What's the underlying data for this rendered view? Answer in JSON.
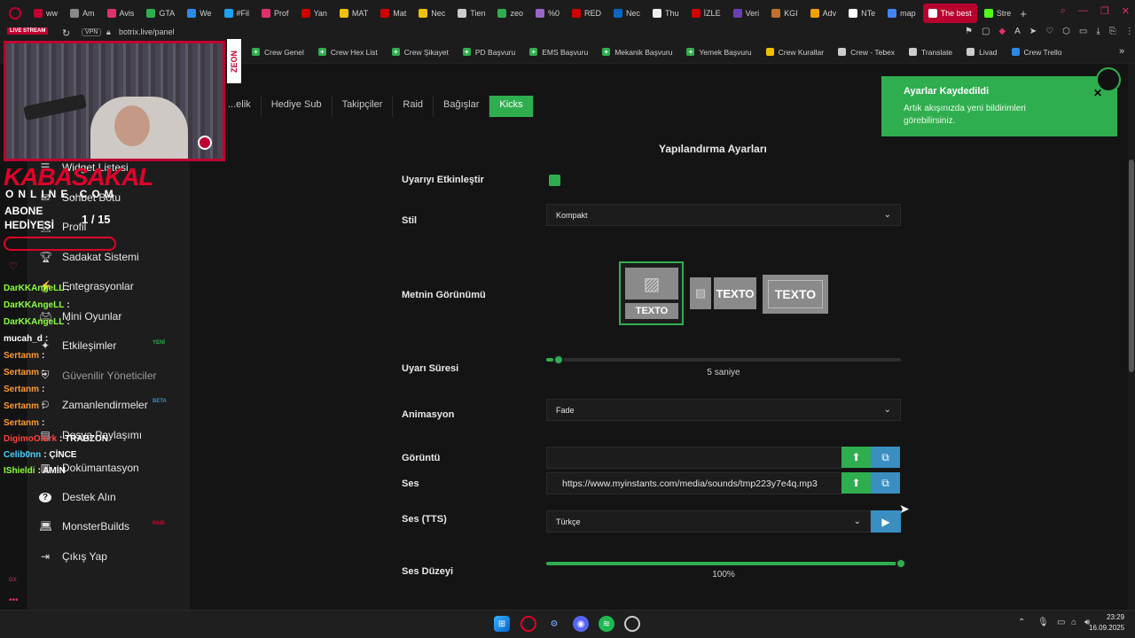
{
  "browser": {
    "tabs": [
      {
        "label": "ww",
        "color": "#c00030"
      },
      {
        "label": "Am",
        "color": "#888888"
      },
      {
        "label": "Avis",
        "color": "#e0306a"
      },
      {
        "label": "GTA",
        "color": "#2fae4f"
      },
      {
        "label": "We",
        "color": "#2b8ae6"
      },
      {
        "label": "#Fil",
        "color": "#1da1f2"
      },
      {
        "label": "Prof",
        "color": "#e0306a"
      },
      {
        "label": "Yan",
        "color": "#d10000"
      },
      {
        "label": "MAT",
        "color": "#f0c000"
      },
      {
        "label": "Mat",
        "color": "#d10000"
      },
      {
        "label": "Nec",
        "color": "#f0c000"
      },
      {
        "label": "Tien",
        "color": "#cccccc"
      },
      {
        "label": "zeo",
        "color": "#2fae4f"
      },
      {
        "label": "%0",
        "color": "#9966cc"
      },
      {
        "label": "RED",
        "color": "#d10000"
      },
      {
        "label": "Nec",
        "color": "#0a66c2"
      },
      {
        "label": "Thu",
        "color": "#eeeeee"
      },
      {
        "label": "İZLE",
        "color": "#d10000"
      },
      {
        "label": "Veri",
        "color": "#6a3fb5"
      },
      {
        "label": "KGI",
        "color": "#c07030"
      },
      {
        "label": "Adv",
        "color": "#f0a000"
      },
      {
        "label": "NTe",
        "color": "#ffffff"
      },
      {
        "label": "map",
        "color": "#4285f4"
      },
      {
        "label": "The best",
        "color": "#ffffff"
      },
      {
        "label": "Stre",
        "color": "#53fc18"
      }
    ],
    "url": "botrix.live/panel",
    "vpn_label": "VPN",
    "bookmarks": [
      {
        "label": "Crew Genel",
        "kind": "plus"
      },
      {
        "label": "Crew Hex List",
        "kind": "plus"
      },
      {
        "label": "Crew Şikayet",
        "kind": "plus"
      },
      {
        "label": "PD Başvuru",
        "kind": "plus"
      },
      {
        "label": "EMS Başvuru",
        "kind": "plus"
      },
      {
        "label": "Mekanik Başvuru",
        "kind": "plus"
      },
      {
        "label": "Yemek Başvuru",
        "kind": "plus"
      },
      {
        "label": "Crew Kurallar",
        "kind": "yellow"
      },
      {
        "label": "Crew - Tebex",
        "kind": "pin"
      },
      {
        "label": "Translate",
        "kind": "arrow"
      },
      {
        "label": "Livad",
        "kind": "circle"
      },
      {
        "label": "Crew Trello",
        "kind": "blue"
      }
    ]
  },
  "sidebar": {
    "items": [
      {
        "label": "Widget Listesi",
        "icon": "list-icon"
      },
      {
        "label": "Sohbet Botu",
        "icon": "chat-icon"
      },
      {
        "label": "Profil",
        "icon": "user-icon"
      },
      {
        "label": "Sadakat Sistemi",
        "icon": "trophy-icon"
      },
      {
        "label": "Entegrasyonlar",
        "icon": "plug-icon"
      },
      {
        "label": "Mini Oyunlar",
        "icon": "gamepad-icon"
      },
      {
        "label": "Etkileşimler",
        "icon": "interaction-icon",
        "badge": "YENİ"
      },
      {
        "label": "Güvenilir Yöneticiler",
        "icon": "shield-icon"
      },
      {
        "label": "Zamanlendirmeler",
        "icon": "clock-icon",
        "badge": "BETA"
      },
      {
        "label": "Dosya Paylaşımı",
        "icon": "file-icon"
      },
      {
        "label": "Dokümantasyon",
        "icon": "book-icon"
      },
      {
        "label": "Destek Alın",
        "icon": "help-icon"
      },
      {
        "label": "MonsterBuilds",
        "icon": "laptop-icon",
        "badge": "PAID"
      },
      {
        "label": "Çıkış Yap",
        "icon": "logout-icon"
      }
    ]
  },
  "content_tabs": [
    {
      "label": "...elik",
      "active": false
    },
    {
      "label": "Hediye Sub",
      "active": false
    },
    {
      "label": "Takipçiler",
      "active": false
    },
    {
      "label": "Raid",
      "active": false
    },
    {
      "label": "Bağışlar",
      "active": false
    },
    {
      "label": "Kicks",
      "active": true
    }
  ],
  "config": {
    "title": "Yapılandırma Ayarları",
    "enable_label": "Uyarıyı Etkinleştir",
    "enable_checked": true,
    "style_label": "Stil",
    "style_value": "Kompakt",
    "text_view_label": "Metnin Görünümü",
    "text_view_options": [
      "TEXTO",
      "TEXTO",
      "TEXTO"
    ],
    "duration_label": "Uyarı Süresi",
    "duration_value": "5 saniye",
    "duration_fraction": 0.02,
    "animation_label": "Animasyon",
    "animation_value": "Fade",
    "image_label": "Görüntü",
    "image_value": "",
    "sound_label": "Ses",
    "sound_value": "https://www.myinstants.com/media/sounds/tmp223y7e4q.mp3",
    "tts_label": "Ses (TTS)",
    "tts_value": "Türkçe",
    "volume_label": "Ses Düzeyi",
    "volume_value": "100%",
    "volume_fraction": 1.0
  },
  "toast": {
    "title": "Ayarlar Kaydedildi",
    "message": "Artık akışınızda yeni bildirimleri görebilirsiniz.",
    "color": "#2fae4f"
  },
  "overlay": {
    "live_label": "LIVE STREAM",
    "brand_line1": "KABASAKAL",
    "brand_line2": "ONLINE.COM",
    "sub_label_1": "ABONE",
    "sub_label_2": "HEDİYESİ",
    "sub_count": "1 / 15",
    "cam_brand": "ZEON",
    "chat": [
      {
        "user": "DarKKAngeLL",
        "text": ":",
        "color": "#8cff3c"
      },
      {
        "user": "DarKKAngeLL",
        "text": ":",
        "color": "#8cff3c"
      },
      {
        "user": "DarKKAngeLL",
        "text": ":",
        "color": "#8cff3c"
      },
      {
        "user": "mucah_d",
        "text": ":",
        "color": "#ffffff"
      },
      {
        "user": "Sertanm",
        "text": ":",
        "color": "#ff9a2e"
      },
      {
        "user": "Sertanm",
        "text": ":",
        "color": "#ff9a2e"
      },
      {
        "user": "Sertanm",
        "text": ":",
        "color": "#ff9a2e"
      },
      {
        "user": "Sertanm",
        "text": ":",
        "color": "#ff9a2e"
      },
      {
        "user": "Sertanm",
        "text": ":",
        "color": "#ff9a2e"
      },
      {
        "user": "DigimoOlurk",
        "text": ": TRABZON",
        "color": "#ff4040"
      },
      {
        "user": "Celib0nn",
        "text": ": ÇİNCE",
        "color": "#4ad1ff"
      },
      {
        "user": "IShieldi",
        "text": ": AMİN",
        "color": "#8cff3c"
      }
    ]
  },
  "taskbar": {
    "time": "23:29",
    "date": "16.09.2025"
  }
}
